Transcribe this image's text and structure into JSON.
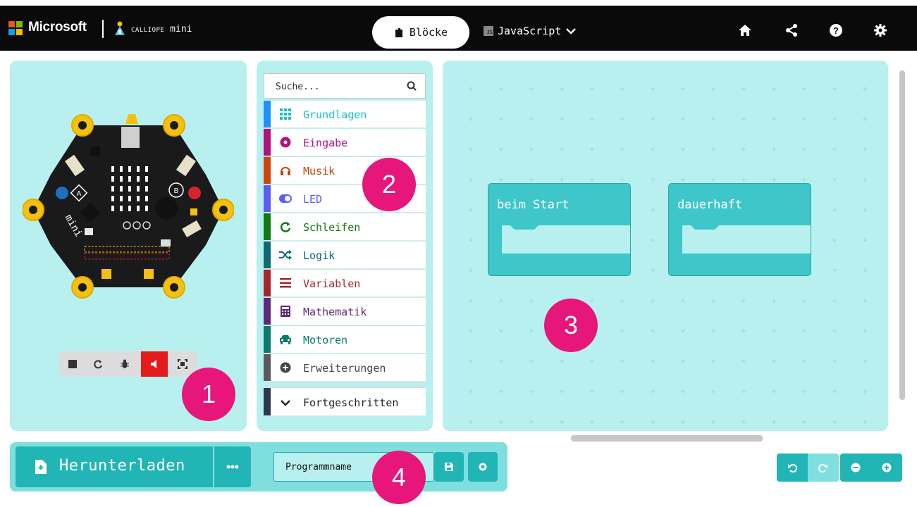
{
  "header": {
    "brand": "Microsoft",
    "product_small": "CALLIOPE",
    "product_rest": " mini",
    "tab_blocks": "Blöcke",
    "tab_js": "JavaScript",
    "js_badge": "JS",
    "icons": [
      "home-icon",
      "share-icon",
      "help-icon",
      "settings-icon"
    ]
  },
  "simulator": {
    "controls": [
      "stop-icon",
      "restart-icon",
      "debug-icon",
      "mute-icon",
      "fullscreen-icon"
    ],
    "muted_color": "#e31b1b"
  },
  "toolbox": {
    "search_placeholder": "Suche...",
    "categories": [
      {
        "label": "Grundlagen",
        "color": "#1e90ff",
        "text_color": "#17c1c4",
        "icon": "grid-icon"
      },
      {
        "label": "Eingabe",
        "color": "#b2127a",
        "text_color": "#b2127a",
        "icon": "radio-icon"
      },
      {
        "label": "Musik",
        "color": "#d1430a",
        "text_color": "#c2430a",
        "icon": "headphones-icon"
      },
      {
        "label": "LED",
        "color": "#5c5cf0",
        "text_color": "#5c5cf0",
        "icon": "toggle-icon"
      },
      {
        "label": "Schleifen",
        "color": "#107c10",
        "text_color": "#107c10",
        "icon": "loop-icon"
      },
      {
        "label": "Logik",
        "color": "#0d6a73",
        "text_color": "#0d6a73",
        "icon": "shuffle-icon"
      },
      {
        "label": "Variablen",
        "color": "#a4262c",
        "text_color": "#a4262c",
        "icon": "list-icon"
      },
      {
        "label": "Mathematik",
        "color": "#5a2b7a",
        "text_color": "#5a2b7a",
        "icon": "calculator-icon"
      },
      {
        "label": "Motoren",
        "color": "#0a7a6a",
        "text_color": "#0a7a6a",
        "icon": "car-icon"
      },
      {
        "label": "Erweiterungen",
        "color": "#5a5a5a",
        "text_color": "#444444",
        "icon": "plus-circle-icon"
      },
      {
        "label": "Fortgeschritten",
        "color": "#2a3a4a",
        "text_color": "#222222",
        "icon": "chevron-down-icon"
      }
    ]
  },
  "workspace": {
    "blocks": [
      {
        "label": "beim Start"
      },
      {
        "label": "dauerhaft"
      }
    ]
  },
  "markers": [
    "1",
    "2",
    "3",
    "4"
  ],
  "bottom": {
    "download_label": "Herunterladen",
    "more_icon": "more-icon",
    "program_name": "Programmname",
    "save_icon": "save-icon",
    "github_icon": "github-icon"
  },
  "colors": {
    "panel": "#b8f0f0",
    "accent": "#22b5b5",
    "block": "#3ec6c9",
    "marker": "#e6167a"
  }
}
